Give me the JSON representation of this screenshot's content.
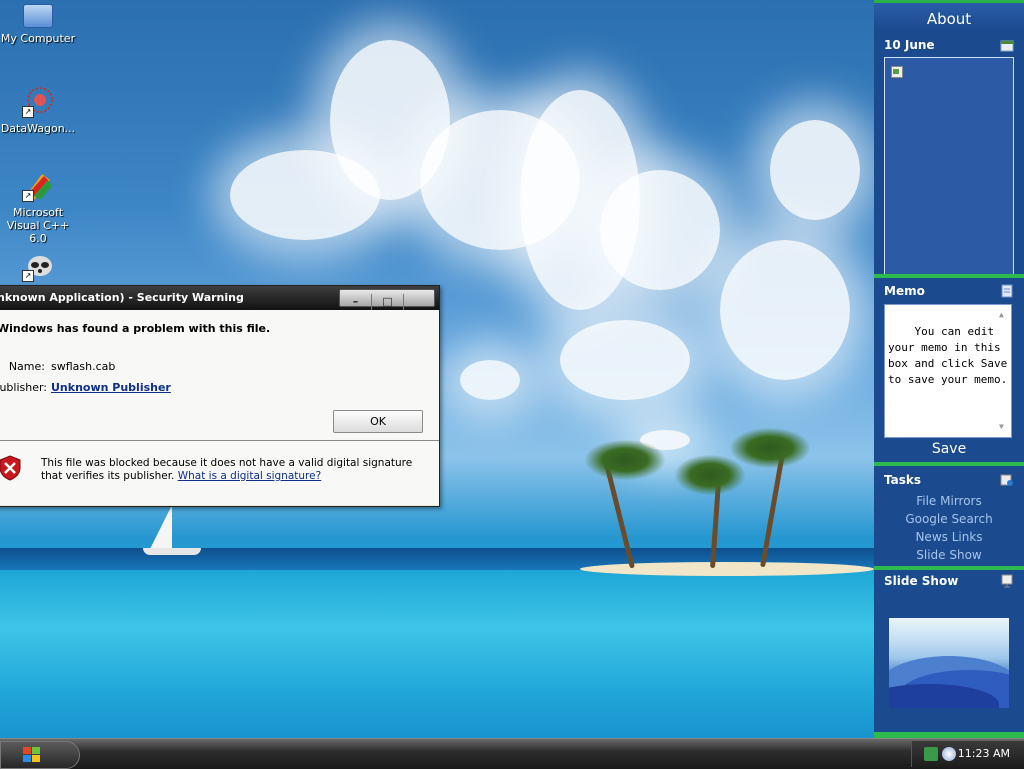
{
  "desktop": {
    "icons": [
      {
        "label": "My Computer"
      },
      {
        "label": "DataWagon..."
      },
      {
        "label": "Microsoft Visual C++ 6.0"
      },
      {
        "label": ""
      }
    ]
  },
  "dialog": {
    "title": "nknown Application) - Security Warning",
    "headline": "Windows has found a problem with this file.",
    "name_label": "Name:",
    "name_value": "swflash.cab",
    "publisher_label": "Publisher:",
    "publisher_value": "Unknown Publisher",
    "ok_label": "OK",
    "footer_text": "This file was blocked because it does not have a valid digital signature that verifies its publisher.",
    "footer_link": "What is a digital signature?"
  },
  "sidebar": {
    "title": "About",
    "date": "10 June",
    "memo_head": "Memo",
    "memo_text": "You can edit your memo in this box and click Save to save your memo.",
    "save_label": "Save",
    "tasks_head": "Tasks",
    "tasks": [
      "File Mirrors",
      "Google Search",
      "News Links",
      "Slide Show"
    ],
    "slideshow_head": "Slide Show"
  },
  "taskbar": {
    "clock": "11:23 AM"
  },
  "colors": {
    "sidebar_bg": "#1b4a8f",
    "sidebar_accent": "#2dbb4e",
    "link": "#0b2f8a"
  }
}
